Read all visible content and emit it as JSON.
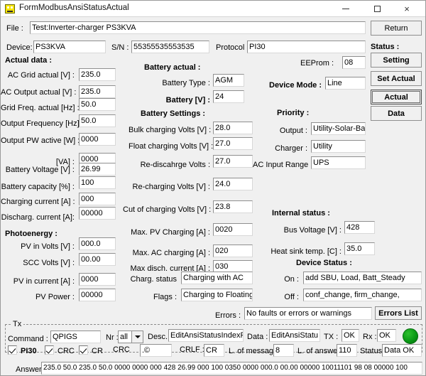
{
  "window": {
    "title": "FormModbusAnsiStatusActual",
    "icon": "app-icon",
    "minimize": "–",
    "maximize": "□",
    "close": "×"
  },
  "header": {
    "file_label": "File :",
    "file_value": "Test:Inverter-charger PS3KVA",
    "device_label": "Device:",
    "device_value": "PS3KVA",
    "sn_label": "S/N :",
    "sn_value": "55355535553535",
    "protocol_label": "Protocol :",
    "protocol_value": "PI30",
    "eeprom_label": "EEProm :",
    "eeprom_value": "08"
  },
  "side": {
    "return_label": "Return",
    "status_label": "Status :",
    "setting_label": "Setting",
    "set_actual_label": "Set Actual",
    "actual_label": "Actual",
    "data_label": "Data"
  },
  "actual_data": {
    "title": "Actual  data :",
    "rows": [
      {
        "label": "AC Grid actual [V] :",
        "value": "235.0"
      },
      {
        "label": "AC Output actual [V] :",
        "value": "235.0"
      },
      {
        "label": "Grid Freq. actual [Hz] :",
        "value": "50.0"
      },
      {
        "label": "Output Frequency [Hz] :",
        "value": "50.0"
      },
      {
        "label": "Output PW active [W] :",
        "value": "0000"
      },
      {
        "label": "[VA] :",
        "value": "0000"
      },
      {
        "label": "Battery Voltage [V] :",
        "value": "26.99"
      },
      {
        "label": "Battery capacity [%] :",
        "value": "100"
      },
      {
        "label": "Charging current  [A] :",
        "value": "000"
      },
      {
        "label": "Discharg. current [A]:",
        "value": "00000"
      }
    ]
  },
  "photoenergy": {
    "title": "Photoenergy :",
    "rows": [
      {
        "label": "PV in Volts [V] :",
        "value": "000.0"
      },
      {
        "label": "SCC Volts [V] :",
        "value": "00.00"
      },
      {
        "label": "PV in current [A] :",
        "value": "0000"
      },
      {
        "label": "PV Power :",
        "value": "00000"
      }
    ]
  },
  "battery_actual": {
    "title": "Battery actual :",
    "type_label": "Battery Type :",
    "type_value": "AGM",
    "volt_label": "Battery [V] :",
    "volt_value": "24"
  },
  "battery_settings": {
    "title": "Battery Settings :",
    "rows": [
      {
        "label": "Bulk charging Volts [V] :",
        "value": "28.0"
      },
      {
        "label": "Float charging Volts [V] :",
        "value": "27.0"
      },
      {
        "label": "Re-discahrge Volts :",
        "value": "27.0"
      },
      {
        "label": "Re-charging Volts [V] :",
        "value": "24.0"
      },
      {
        "label": "Cut of charging Volts [V] :",
        "value": "23.8"
      },
      {
        "label": "Max. PV Charging [A] :",
        "value": "0020"
      },
      {
        "label": "Max. AC charging [A] :",
        "value": "020"
      },
      {
        "label": "Max disch. current [A] :",
        "value": "030"
      }
    ],
    "charg_status_label": "Charg. status",
    "charg_status_value": "Charging with AC",
    "flags_label": "Flags :",
    "flags_value": "Charging to Floating,"
  },
  "priority": {
    "device_mode_label": "Device Mode :",
    "device_mode_value": "Line",
    "title": "Priority :",
    "output_label": "Output :",
    "output_value": "Utility-Solar-Bat",
    "charger_label": "Charger :",
    "charger_value": "Utility",
    "ac_input_label": "AC Input Range :",
    "ac_input_value": "UPS"
  },
  "internal_status": {
    "title": "Internal status :",
    "bus_label": "Bus Voltage [V] :",
    "bus_value": "428",
    "heat_label": "Heat sink temp. [C] :",
    "heat_value": "35.0"
  },
  "device_status": {
    "title": "Device Status :",
    "on_label": "On :",
    "on_value": "add SBU, Load, Batt_Steady",
    "off_label": "Off :",
    "off_value": "conf_change, firm_change,"
  },
  "errors": {
    "label": "Errors :",
    "value": "No faults or errors or warnings",
    "button": "Errors List"
  },
  "tx": {
    "group_title": "Tx",
    "command_label": "Command :",
    "command_value": "QPIGS",
    "nr_label": "Nr :",
    "nr_value": "all",
    "desc_label": "Desc.:",
    "desc_value": "EditAnsiStatusIndexPopis",
    "data_label": "Data :",
    "data_value": "EditAnsiStatu",
    "tx_label": "TX :",
    "tx_value": "OK",
    "rx_label": "Rx :",
    "rx_value": "OK",
    "led": "status-led-green",
    "pi30_label": "PI30",
    "crc_label": "CRC",
    "cr_label": "CR",
    "crc2_label": "CRC",
    "crc2_value": ".©",
    "crlf_label": "CRLF :",
    "crlf_value": "CR",
    "len_msg_label": "L. of message :",
    "len_msg_value": "8",
    "len_ans_label": "L. of answer :",
    "len_ans_value": "110",
    "status_label": "Status :",
    "status_value": "Data OK",
    "answer_label": "Answer :",
    "answer_value": "235.0 50.0 235.0 50.0 0000 0000 000 428 26.99 000 100 0350 0000 000.0 00.00 00000 10011101 98 08 00000 100"
  },
  "colors": {
    "window_bg": "#f0f0f0",
    "field_bg": "#ffffff",
    "led_green": "#0a9a16",
    "title_bg": "#ffffff"
  }
}
